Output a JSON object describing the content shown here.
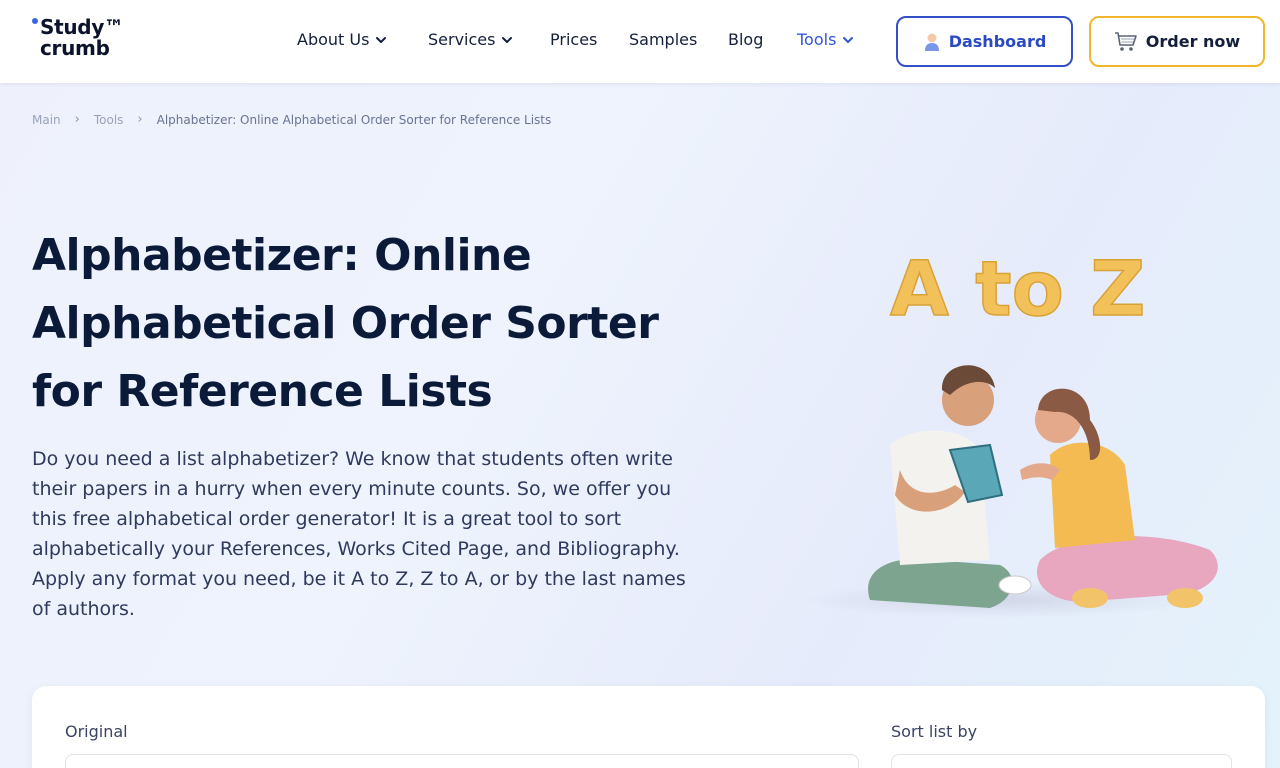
{
  "header": {
    "logo": {
      "line1": "Study™",
      "line2": "crumb"
    },
    "nav": [
      {
        "label": "About Us",
        "has_dropdown": true
      },
      {
        "label": "Services",
        "has_dropdown": true
      },
      {
        "label": "Prices",
        "has_dropdown": false
      },
      {
        "label": "Samples",
        "has_dropdown": false
      },
      {
        "label": "Blog",
        "has_dropdown": false
      },
      {
        "label": "Tools",
        "has_dropdown": true,
        "active": true
      }
    ],
    "dashboard_label": "Dashboard",
    "order_label": "Order now"
  },
  "breadcrumb": {
    "items": [
      "Main",
      "Tools"
    ],
    "current": "Alphabetizer: Online Alphabetical Order Sorter for Reference Lists"
  },
  "hero": {
    "title": "Alphabetizer: Online Alphabetical Order Sorter for Reference Lists",
    "lead": "Do you need a list alphabetizer? We know that students often write their papers in a hurry when every minute counts. So, we offer you this free alphabetical order generator! It is a great tool to sort alphabetically your References, Works Cited Page, and Bibliography. Apply any format you need, be it A to Z, Z to A, or by the last names of authors.",
    "illustration_text": "A to Z"
  },
  "tool": {
    "original_label": "Original",
    "sort_label": "Sort list by"
  },
  "colors": {
    "brand_blue": "#3350c8",
    "active_nav": "#3157d8",
    "order_border": "#f2b62a",
    "title": "#0c1a3a"
  },
  "icons": {
    "dashboard": "user-icon",
    "order": "cart-icon",
    "dropdown": "chevron-down-icon",
    "breadcrumb_sep": "chevron-right-icon"
  }
}
